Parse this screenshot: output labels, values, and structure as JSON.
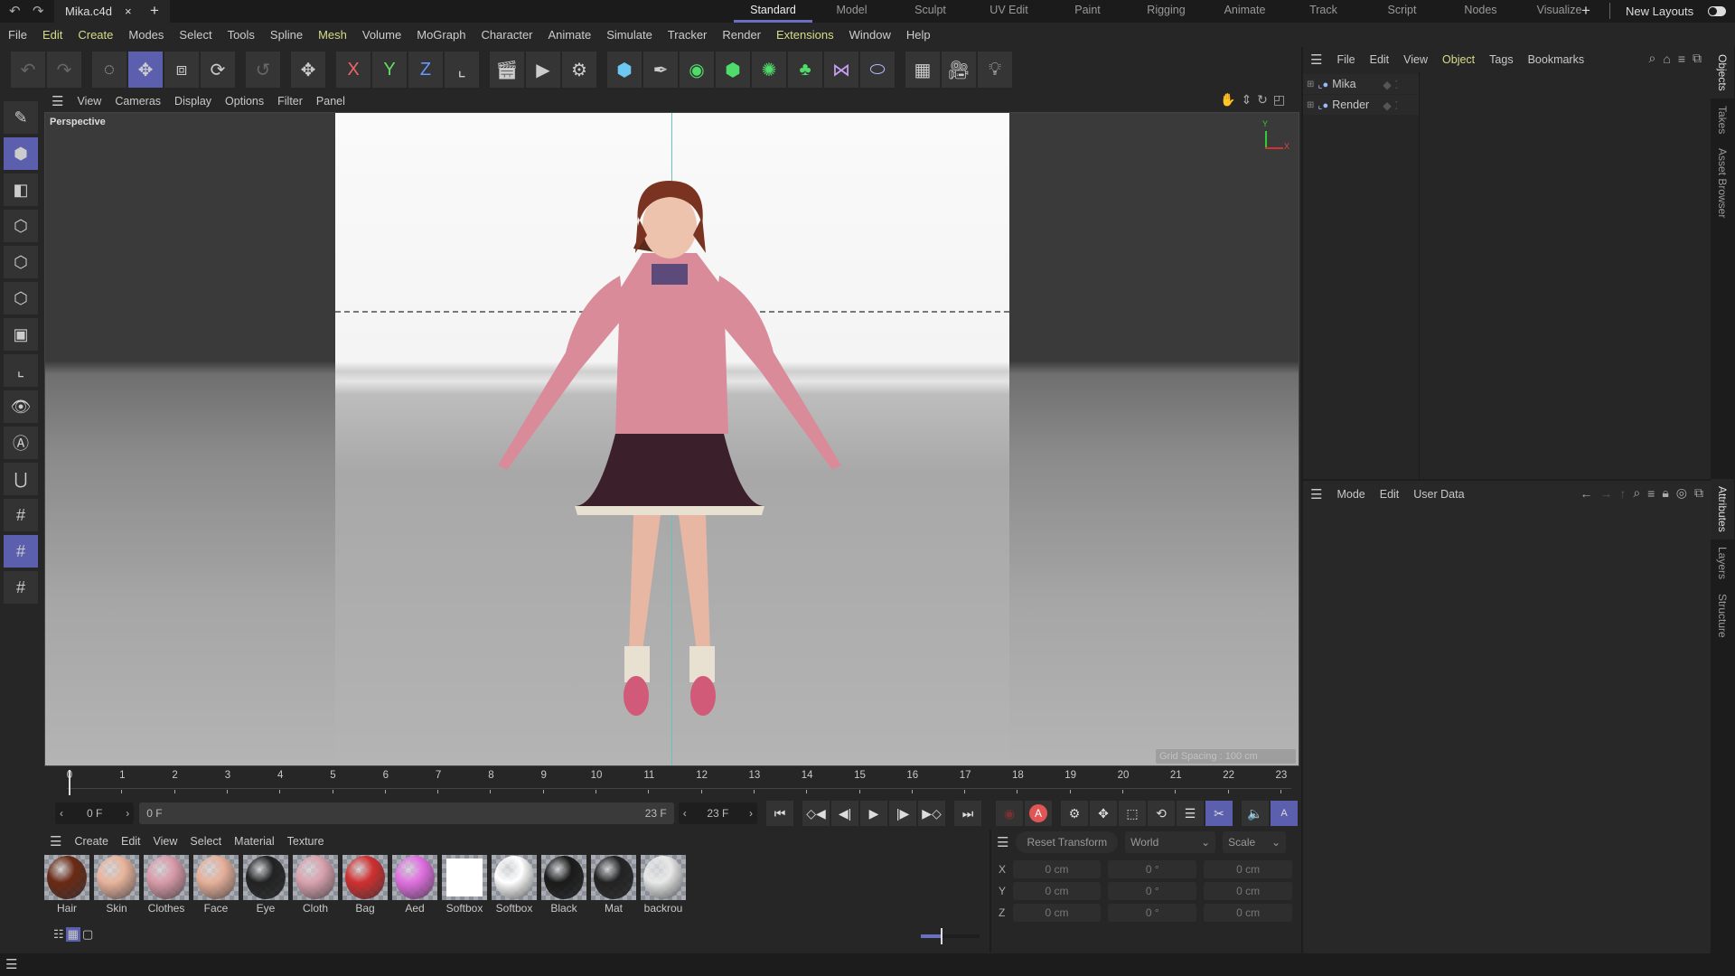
{
  "topbar": {
    "file_tab": "Mika.c4d",
    "layouts": [
      "Standard",
      "Model",
      "Sculpt",
      "UV Edit",
      "Paint",
      "Rigging",
      "Animate",
      "Track",
      "Script",
      "Nodes",
      "Visualize"
    ],
    "active_layout": "Standard",
    "new_layouts": "New Layouts"
  },
  "menu": [
    "File",
    "Edit",
    "Create",
    "Modes",
    "Select",
    "Tools",
    "Spline",
    "Mesh",
    "Volume",
    "MoGraph",
    "Character",
    "Animate",
    "Simulate",
    "Tracker",
    "Render",
    "Extensions",
    "Window",
    "Help"
  ],
  "menu_highlight": [
    "Edit",
    "Create",
    "Mesh",
    "Extensions"
  ],
  "toolbar": {
    "groups": [
      [
        "undo",
        "redo"
      ],
      [
        "live-selection",
        "move",
        "scale",
        "rotate"
      ],
      [
        "recent-tool"
      ],
      [
        "transform"
      ],
      [
        "x-axis",
        "y-axis",
        "z-axis",
        "coordinate-system"
      ],
      [
        "render-view",
        "render-picture-viewer",
        "render-settings"
      ],
      [
        "cube",
        "pen",
        "subdivision",
        "extrude",
        "cloner",
        "mograph-fracture",
        "deformer",
        "field"
      ],
      [
        "floor",
        "camera",
        "light"
      ]
    ],
    "active": "move"
  },
  "viewport": {
    "menu": [
      "View",
      "Cameras",
      "Display",
      "Options",
      "Filter",
      "Panel"
    ],
    "label": "Perspective",
    "grid_spacing": "Grid Spacing : 100 cm",
    "axis": {
      "x": "X",
      "y": "Y"
    }
  },
  "left_tools": [
    "make-editable",
    "model-mode",
    "texture-mode",
    "point-mode",
    "edge-mode",
    "polygon-mode",
    "uv-mode",
    "axis-mode",
    "solo",
    "viewport-solo",
    "snap",
    "workplane",
    "locked-workplane",
    "planar-workplane"
  ],
  "left_active": [
    "model-mode",
    "locked-workplane"
  ],
  "timeline": {
    "ticks": [
      "0",
      "1",
      "2",
      "3",
      "4",
      "5",
      "6",
      "7",
      "8",
      "9",
      "10",
      "11",
      "12",
      "13",
      "14",
      "15",
      "16",
      "17",
      "18",
      "19",
      "20",
      "21",
      "22",
      "23"
    ],
    "current": "0 F",
    "range_start": "0 F",
    "range_end": "23 F",
    "end": "23 F"
  },
  "materials": {
    "menu": [
      "Create",
      "Edit",
      "View",
      "Select",
      "Material",
      "Texture"
    ],
    "items": [
      {
        "name": "Hair",
        "color": "#6a2a14"
      },
      {
        "name": "Skin",
        "color": "#e8b49c"
      },
      {
        "name": "Clothes",
        "color": "#d89aa8"
      },
      {
        "name": "Face",
        "color": "#e6b09a"
      },
      {
        "name": "Eye",
        "color": "#222222"
      },
      {
        "name": "Cloth",
        "color": "#d8a2ae"
      },
      {
        "name": "Bag",
        "color": "#d03030"
      },
      {
        "name": "Aed",
        "color": "#e070e0"
      },
      {
        "name": "Softbox",
        "color": "#ffffff"
      },
      {
        "name": "Softbox",
        "color": "#ffffff"
      },
      {
        "name": "Black",
        "color": "#1a1a1a"
      },
      {
        "name": "Mat",
        "color": "#222222"
      },
      {
        "name": "backrou",
        "color": "#e8e8e8"
      }
    ]
  },
  "coords": {
    "reset": "Reset Transform",
    "space": "World",
    "mode": "Scale",
    "rows": [
      {
        "axis": "X",
        "pos": "0 cm",
        "rot": "0 °",
        "size": "0 cm"
      },
      {
        "axis": "Y",
        "pos": "0 cm",
        "rot": "0 °",
        "size": "0 cm"
      },
      {
        "axis": "Z",
        "pos": "0 cm",
        "rot": "0 °",
        "size": "0 cm"
      }
    ]
  },
  "objects": {
    "menu": [
      "File",
      "Edit",
      "View",
      "Object",
      "Tags",
      "Bookmarks"
    ],
    "active_menu": "Object",
    "items": [
      "Mika",
      "Render"
    ]
  },
  "attributes": {
    "menu": [
      "Mode",
      "Edit",
      "User Data"
    ]
  },
  "side_tabs_top": [
    "Objects",
    "Takes",
    "Asset Browser"
  ],
  "side_tabs_bottom": [
    "Attributes",
    "Layers",
    "Structure"
  ]
}
